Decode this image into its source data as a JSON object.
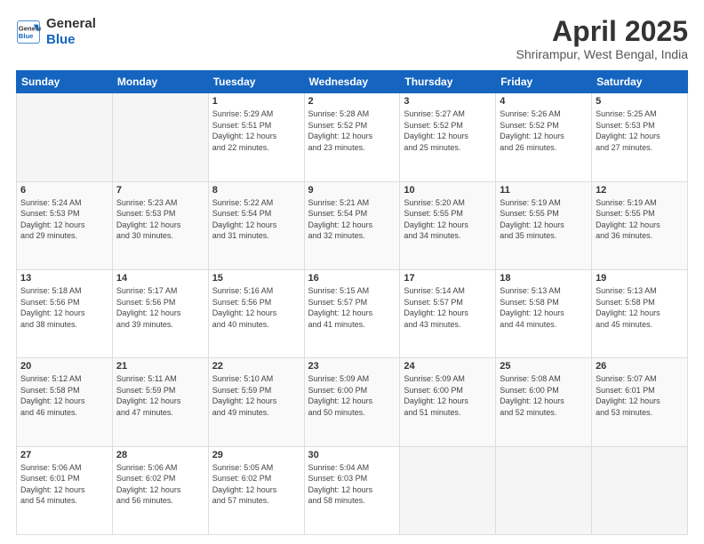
{
  "header": {
    "logo_line1": "General",
    "logo_line2": "Blue",
    "month": "April 2025",
    "location": "Shrirampur, West Bengal, India"
  },
  "weekdays": [
    "Sunday",
    "Monday",
    "Tuesday",
    "Wednesday",
    "Thursday",
    "Friday",
    "Saturday"
  ],
  "weeks": [
    [
      {
        "day": "",
        "info": ""
      },
      {
        "day": "",
        "info": ""
      },
      {
        "day": "1",
        "info": "Sunrise: 5:29 AM\nSunset: 5:51 PM\nDaylight: 12 hours\nand 22 minutes."
      },
      {
        "day": "2",
        "info": "Sunrise: 5:28 AM\nSunset: 5:52 PM\nDaylight: 12 hours\nand 23 minutes."
      },
      {
        "day": "3",
        "info": "Sunrise: 5:27 AM\nSunset: 5:52 PM\nDaylight: 12 hours\nand 25 minutes."
      },
      {
        "day": "4",
        "info": "Sunrise: 5:26 AM\nSunset: 5:52 PM\nDaylight: 12 hours\nand 26 minutes."
      },
      {
        "day": "5",
        "info": "Sunrise: 5:25 AM\nSunset: 5:53 PM\nDaylight: 12 hours\nand 27 minutes."
      }
    ],
    [
      {
        "day": "6",
        "info": "Sunrise: 5:24 AM\nSunset: 5:53 PM\nDaylight: 12 hours\nand 29 minutes."
      },
      {
        "day": "7",
        "info": "Sunrise: 5:23 AM\nSunset: 5:53 PM\nDaylight: 12 hours\nand 30 minutes."
      },
      {
        "day": "8",
        "info": "Sunrise: 5:22 AM\nSunset: 5:54 PM\nDaylight: 12 hours\nand 31 minutes."
      },
      {
        "day": "9",
        "info": "Sunrise: 5:21 AM\nSunset: 5:54 PM\nDaylight: 12 hours\nand 32 minutes."
      },
      {
        "day": "10",
        "info": "Sunrise: 5:20 AM\nSunset: 5:55 PM\nDaylight: 12 hours\nand 34 minutes."
      },
      {
        "day": "11",
        "info": "Sunrise: 5:19 AM\nSunset: 5:55 PM\nDaylight: 12 hours\nand 35 minutes."
      },
      {
        "day": "12",
        "info": "Sunrise: 5:19 AM\nSunset: 5:55 PM\nDaylight: 12 hours\nand 36 minutes."
      }
    ],
    [
      {
        "day": "13",
        "info": "Sunrise: 5:18 AM\nSunset: 5:56 PM\nDaylight: 12 hours\nand 38 minutes."
      },
      {
        "day": "14",
        "info": "Sunrise: 5:17 AM\nSunset: 5:56 PM\nDaylight: 12 hours\nand 39 minutes."
      },
      {
        "day": "15",
        "info": "Sunrise: 5:16 AM\nSunset: 5:56 PM\nDaylight: 12 hours\nand 40 minutes."
      },
      {
        "day": "16",
        "info": "Sunrise: 5:15 AM\nSunset: 5:57 PM\nDaylight: 12 hours\nand 41 minutes."
      },
      {
        "day": "17",
        "info": "Sunrise: 5:14 AM\nSunset: 5:57 PM\nDaylight: 12 hours\nand 43 minutes."
      },
      {
        "day": "18",
        "info": "Sunrise: 5:13 AM\nSunset: 5:58 PM\nDaylight: 12 hours\nand 44 minutes."
      },
      {
        "day": "19",
        "info": "Sunrise: 5:13 AM\nSunset: 5:58 PM\nDaylight: 12 hours\nand 45 minutes."
      }
    ],
    [
      {
        "day": "20",
        "info": "Sunrise: 5:12 AM\nSunset: 5:58 PM\nDaylight: 12 hours\nand 46 minutes."
      },
      {
        "day": "21",
        "info": "Sunrise: 5:11 AM\nSunset: 5:59 PM\nDaylight: 12 hours\nand 47 minutes."
      },
      {
        "day": "22",
        "info": "Sunrise: 5:10 AM\nSunset: 5:59 PM\nDaylight: 12 hours\nand 49 minutes."
      },
      {
        "day": "23",
        "info": "Sunrise: 5:09 AM\nSunset: 6:00 PM\nDaylight: 12 hours\nand 50 minutes."
      },
      {
        "day": "24",
        "info": "Sunrise: 5:09 AM\nSunset: 6:00 PM\nDaylight: 12 hours\nand 51 minutes."
      },
      {
        "day": "25",
        "info": "Sunrise: 5:08 AM\nSunset: 6:00 PM\nDaylight: 12 hours\nand 52 minutes."
      },
      {
        "day": "26",
        "info": "Sunrise: 5:07 AM\nSunset: 6:01 PM\nDaylight: 12 hours\nand 53 minutes."
      }
    ],
    [
      {
        "day": "27",
        "info": "Sunrise: 5:06 AM\nSunset: 6:01 PM\nDaylight: 12 hours\nand 54 minutes."
      },
      {
        "day": "28",
        "info": "Sunrise: 5:06 AM\nSunset: 6:02 PM\nDaylight: 12 hours\nand 56 minutes."
      },
      {
        "day": "29",
        "info": "Sunrise: 5:05 AM\nSunset: 6:02 PM\nDaylight: 12 hours\nand 57 minutes."
      },
      {
        "day": "30",
        "info": "Sunrise: 5:04 AM\nSunset: 6:03 PM\nDaylight: 12 hours\nand 58 minutes."
      },
      {
        "day": "",
        "info": ""
      },
      {
        "day": "",
        "info": ""
      },
      {
        "day": "",
        "info": ""
      }
    ]
  ]
}
